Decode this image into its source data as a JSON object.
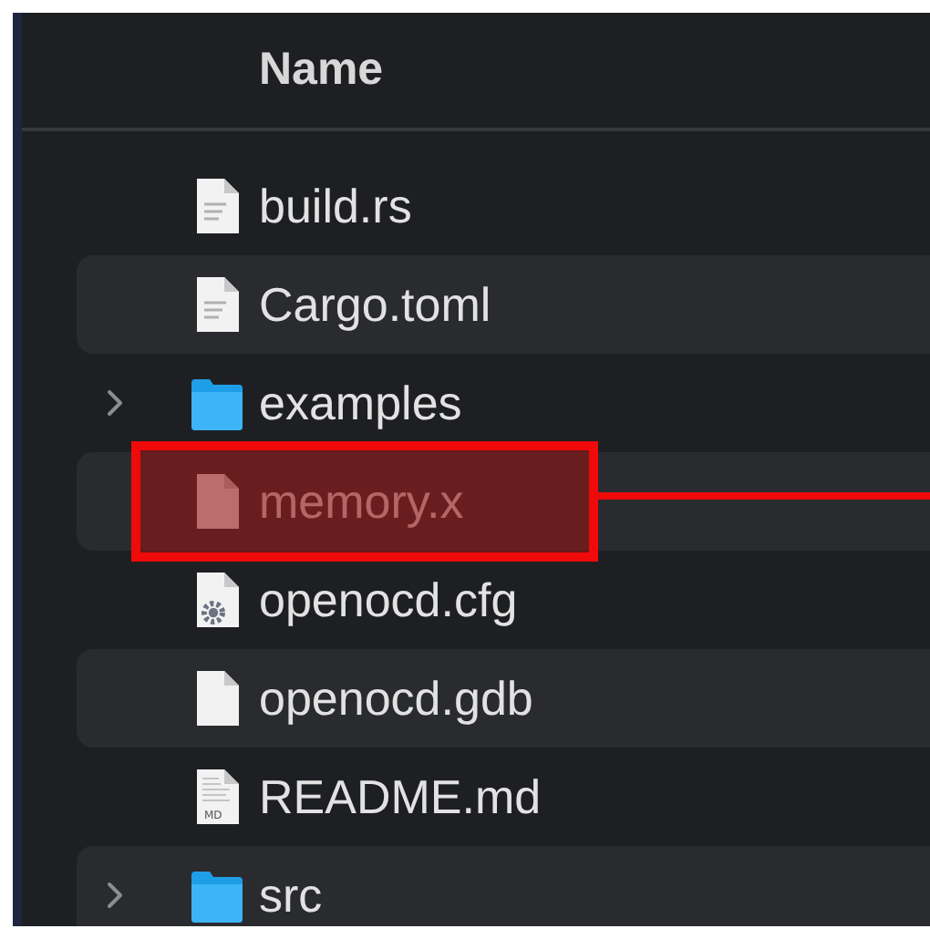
{
  "column_header": "Name",
  "files": [
    {
      "name": "build.rs",
      "kind": "text-file",
      "highlighted": false
    },
    {
      "name": "Cargo.toml",
      "kind": "text-file",
      "highlighted": false
    },
    {
      "name": "examples",
      "kind": "folder",
      "expanded": false,
      "highlighted": false
    },
    {
      "name": "memory.x",
      "kind": "file",
      "highlighted": true
    },
    {
      "name": "openocd.cfg",
      "kind": "config-file",
      "highlighted": false
    },
    {
      "name": "openocd.gdb",
      "kind": "file",
      "highlighted": false
    },
    {
      "name": "README.md",
      "kind": "markdown-file",
      "icon_label": "MD",
      "highlighted": false
    },
    {
      "name": "src",
      "kind": "folder",
      "expanded": false,
      "highlighted": false
    }
  ]
}
